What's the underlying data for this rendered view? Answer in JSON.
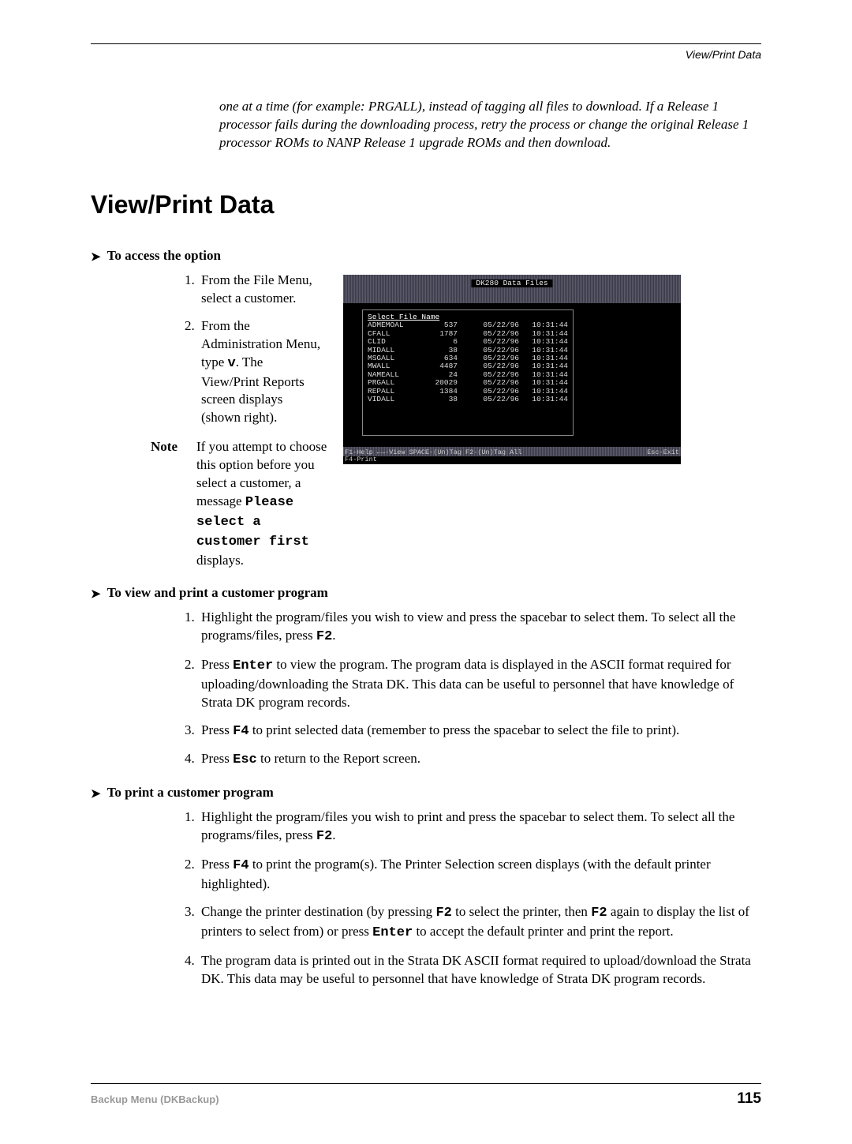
{
  "header": {
    "section_label": "View/Print Data"
  },
  "intro": "one at a time (for example: PRGALL), instead of tagging all files to download. If a Release 1 processor fails during the downloading process, retry the process or change the original Release 1 processor ROMs to NANP Release 1 upgrade ROMs and then download.",
  "title": "View/Print Data",
  "access": {
    "heading": "To access the option",
    "step1": "From the File Menu, select a customer.",
    "step2_a": "From the Administration Menu, type ",
    "step2_key": "v",
    "step2_b": ". The View/Print Reports screen displays (shown right).",
    "note_label": "Note",
    "note_a": "If you attempt to choose this option before you select a customer, a message ",
    "note_b": "Please select a customer first",
    "note_c": " displays."
  },
  "terminal": {
    "title": "DK280 Data Files",
    "select_label": "Select File Name",
    "files": [
      {
        "name": "ADMEMOAL",
        "size": "537",
        "date": "05/22/96",
        "time": "10:31:44"
      },
      {
        "name": "CFALL",
        "size": "1787",
        "date": "05/22/96",
        "time": "10:31:44"
      },
      {
        "name": "CLID",
        "size": "6",
        "date": "05/22/96",
        "time": "10:31:44"
      },
      {
        "name": "MIDALL",
        "size": "38",
        "date": "05/22/96",
        "time": "10:31:44"
      },
      {
        "name": "MSGALL",
        "size": "634",
        "date": "05/22/96",
        "time": "10:31:44"
      },
      {
        "name": "MWALL",
        "size": "4487",
        "date": "05/22/96",
        "time": "10:31:44"
      },
      {
        "name": "NAMEALL",
        "size": "24",
        "date": "05/22/96",
        "time": "10:31:44"
      },
      {
        "name": "PRGALL",
        "size": "20029",
        "date": "05/22/96",
        "time": "10:31:44"
      },
      {
        "name": "REPALL",
        "size": "1384",
        "date": "05/22/96",
        "time": "10:31:44"
      },
      {
        "name": "VIDALL",
        "size": "38",
        "date": "05/22/96",
        "time": "10:31:44"
      }
    ],
    "foot_left": "F1-Help  ←→-View  SPACE-(Un)Tag  F2-(Un)Tag All",
    "foot_left2": "F4-Print",
    "foot_right": "Esc-Exit"
  },
  "viewprint": {
    "heading": "To view and print a customer program",
    "s1a": "Highlight the program/files you wish to view and press the spacebar to select them. To select all the programs/files, press ",
    "s1k": "F2",
    "s1b": ".",
    "s2a": "Press ",
    "s2k": "Enter",
    "s2b": " to view the program. The program data is displayed in the ASCII format required for uploading/downloading the Strata DK. This data can be useful to personnel that have knowledge of Strata DK program records.",
    "s3a": "Press ",
    "s3k": "F4",
    "s3b": " to print selected data (remember to press the spacebar to select the file to print).",
    "s4a": "Press ",
    "s4k": "Esc",
    "s4b": " to return to the Report screen."
  },
  "print": {
    "heading": "To print a customer program",
    "s1a": "Highlight the program/files you wish to print and press the spacebar to select them. To select all the programs/files, press ",
    "s1k": "F2",
    "s1b": ".",
    "s2a": "Press ",
    "s2k": "F4",
    "s2b": " to print the program(s). The Printer Selection screen displays (with the default printer highlighted).",
    "s3a": "Change the printer destination (by pressing ",
    "s3k1": "F2",
    "s3b": " to select the printer, then ",
    "s3k2": "F2",
    "s3c": " again to display the list of printers to select from) or press ",
    "s3k3": "Enter",
    "s3d": " to accept the default printer and print the report.",
    "s4": "The program data is printed out in the Strata DK ASCII format required to upload/download the Strata DK. This data may be useful to personnel that have knowledge of Strata DK program records."
  },
  "footer": {
    "left": "Backup Menu (DKBackup)",
    "page": "115"
  }
}
